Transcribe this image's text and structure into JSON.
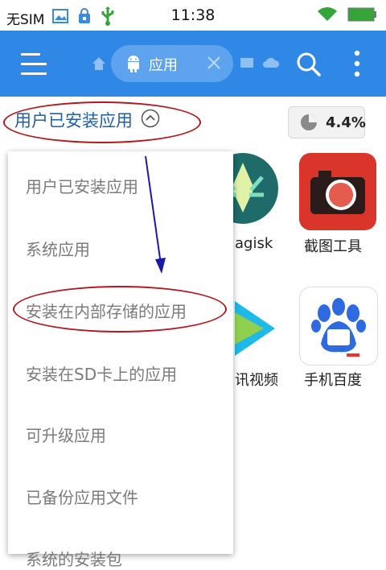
{
  "status_bar": {
    "carrier": "无SIM",
    "time": "11:38"
  },
  "toolbar": {
    "tab_label": "应用"
  },
  "filter": {
    "label": "用户已安装应用",
    "storage_percent": "4.4%"
  },
  "apps": [
    {
      "label": "agisk"
    },
    {
      "label": "截图工具"
    },
    {
      "label": "讯视频"
    },
    {
      "label": "手机百度"
    }
  ],
  "dropdown": {
    "items": [
      "用户已安装应用",
      "系统应用",
      "安装在内部存储的应用",
      "安装在SD卡上的应用",
      "可升级应用",
      "已备份应用文件",
      "系统的安装包"
    ]
  },
  "colors": {
    "toolbar": "#2f87e6",
    "annotation_red": "#b3191c",
    "annotation_arrow": "#1a1aa8"
  }
}
